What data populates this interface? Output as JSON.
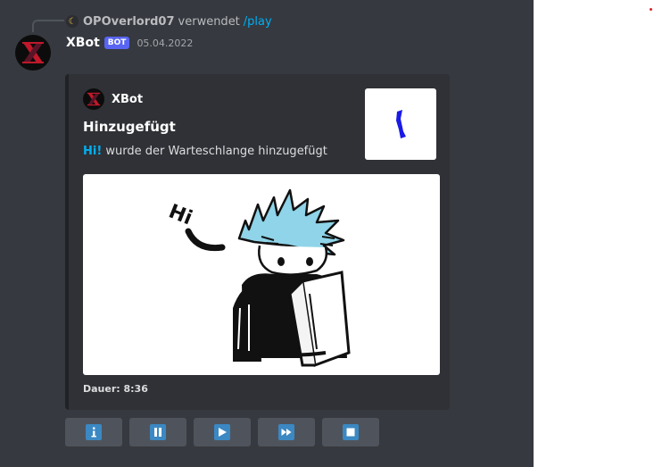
{
  "reply": {
    "username": "OPOverlord07",
    "verb": "verwendet",
    "command": "/play"
  },
  "message": {
    "username": "XBot",
    "bot_tag": "BOT",
    "timestamp": "05.04.2022"
  },
  "embed": {
    "author": "XBot",
    "title": "Hinzugefügt",
    "song_title": "Hi!",
    "description_rest": " wurde der Warteschlange hinzugefügt",
    "footer": "Dauer: 8:36",
    "image_text": "Hi"
  },
  "buttons": [
    {
      "name": "info",
      "icon": "info-icon"
    },
    {
      "name": "pause",
      "icon": "pause-icon"
    },
    {
      "name": "play",
      "icon": "play-icon"
    },
    {
      "name": "skip",
      "icon": "fast-forward-icon"
    },
    {
      "name": "stop",
      "icon": "stop-icon"
    }
  ],
  "colors": {
    "background": "#36393f",
    "embed": "#2f3136",
    "link": "#00aff4",
    "bot_tag": "#5865f2",
    "button": "#4f545c",
    "button_glyph": "#3b88c3",
    "avatar_logo": "#c0182a",
    "thumbnail_mark": "#1a1ae6",
    "hair": "#8fd4e8"
  }
}
